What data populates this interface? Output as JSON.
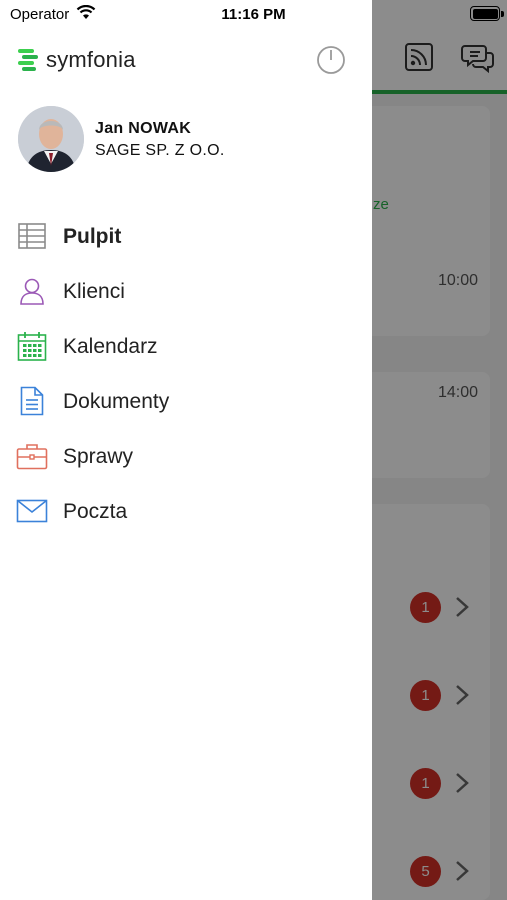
{
  "status_bar": {
    "carrier": "Operator",
    "time": "11:16 PM"
  },
  "app": {
    "brand": "symfonia"
  },
  "user": {
    "name": "Jan NOWAK",
    "company": "SAGE SP. Z O.O."
  },
  "menu": [
    {
      "label": "Pulpit",
      "icon": "grid-icon",
      "active": true
    },
    {
      "label": "Klienci",
      "icon": "person-icon",
      "active": false
    },
    {
      "label": "Kalendarz",
      "icon": "calendar-icon",
      "active": false
    },
    {
      "label": "Dokumenty",
      "icon": "document-icon",
      "active": false
    },
    {
      "label": "Sprawy",
      "icon": "briefcase-icon",
      "active": false
    },
    {
      "label": "Poczta",
      "icon": "mail-icon",
      "active": false
    }
  ],
  "background": {
    "times": [
      "10:00",
      "14:00"
    ],
    "green_fragment": "ze",
    "badges": [
      "1",
      "1",
      "1",
      "5"
    ]
  },
  "colors": {
    "brand_green": "#2bb24c",
    "badge_red": "#d33027"
  }
}
